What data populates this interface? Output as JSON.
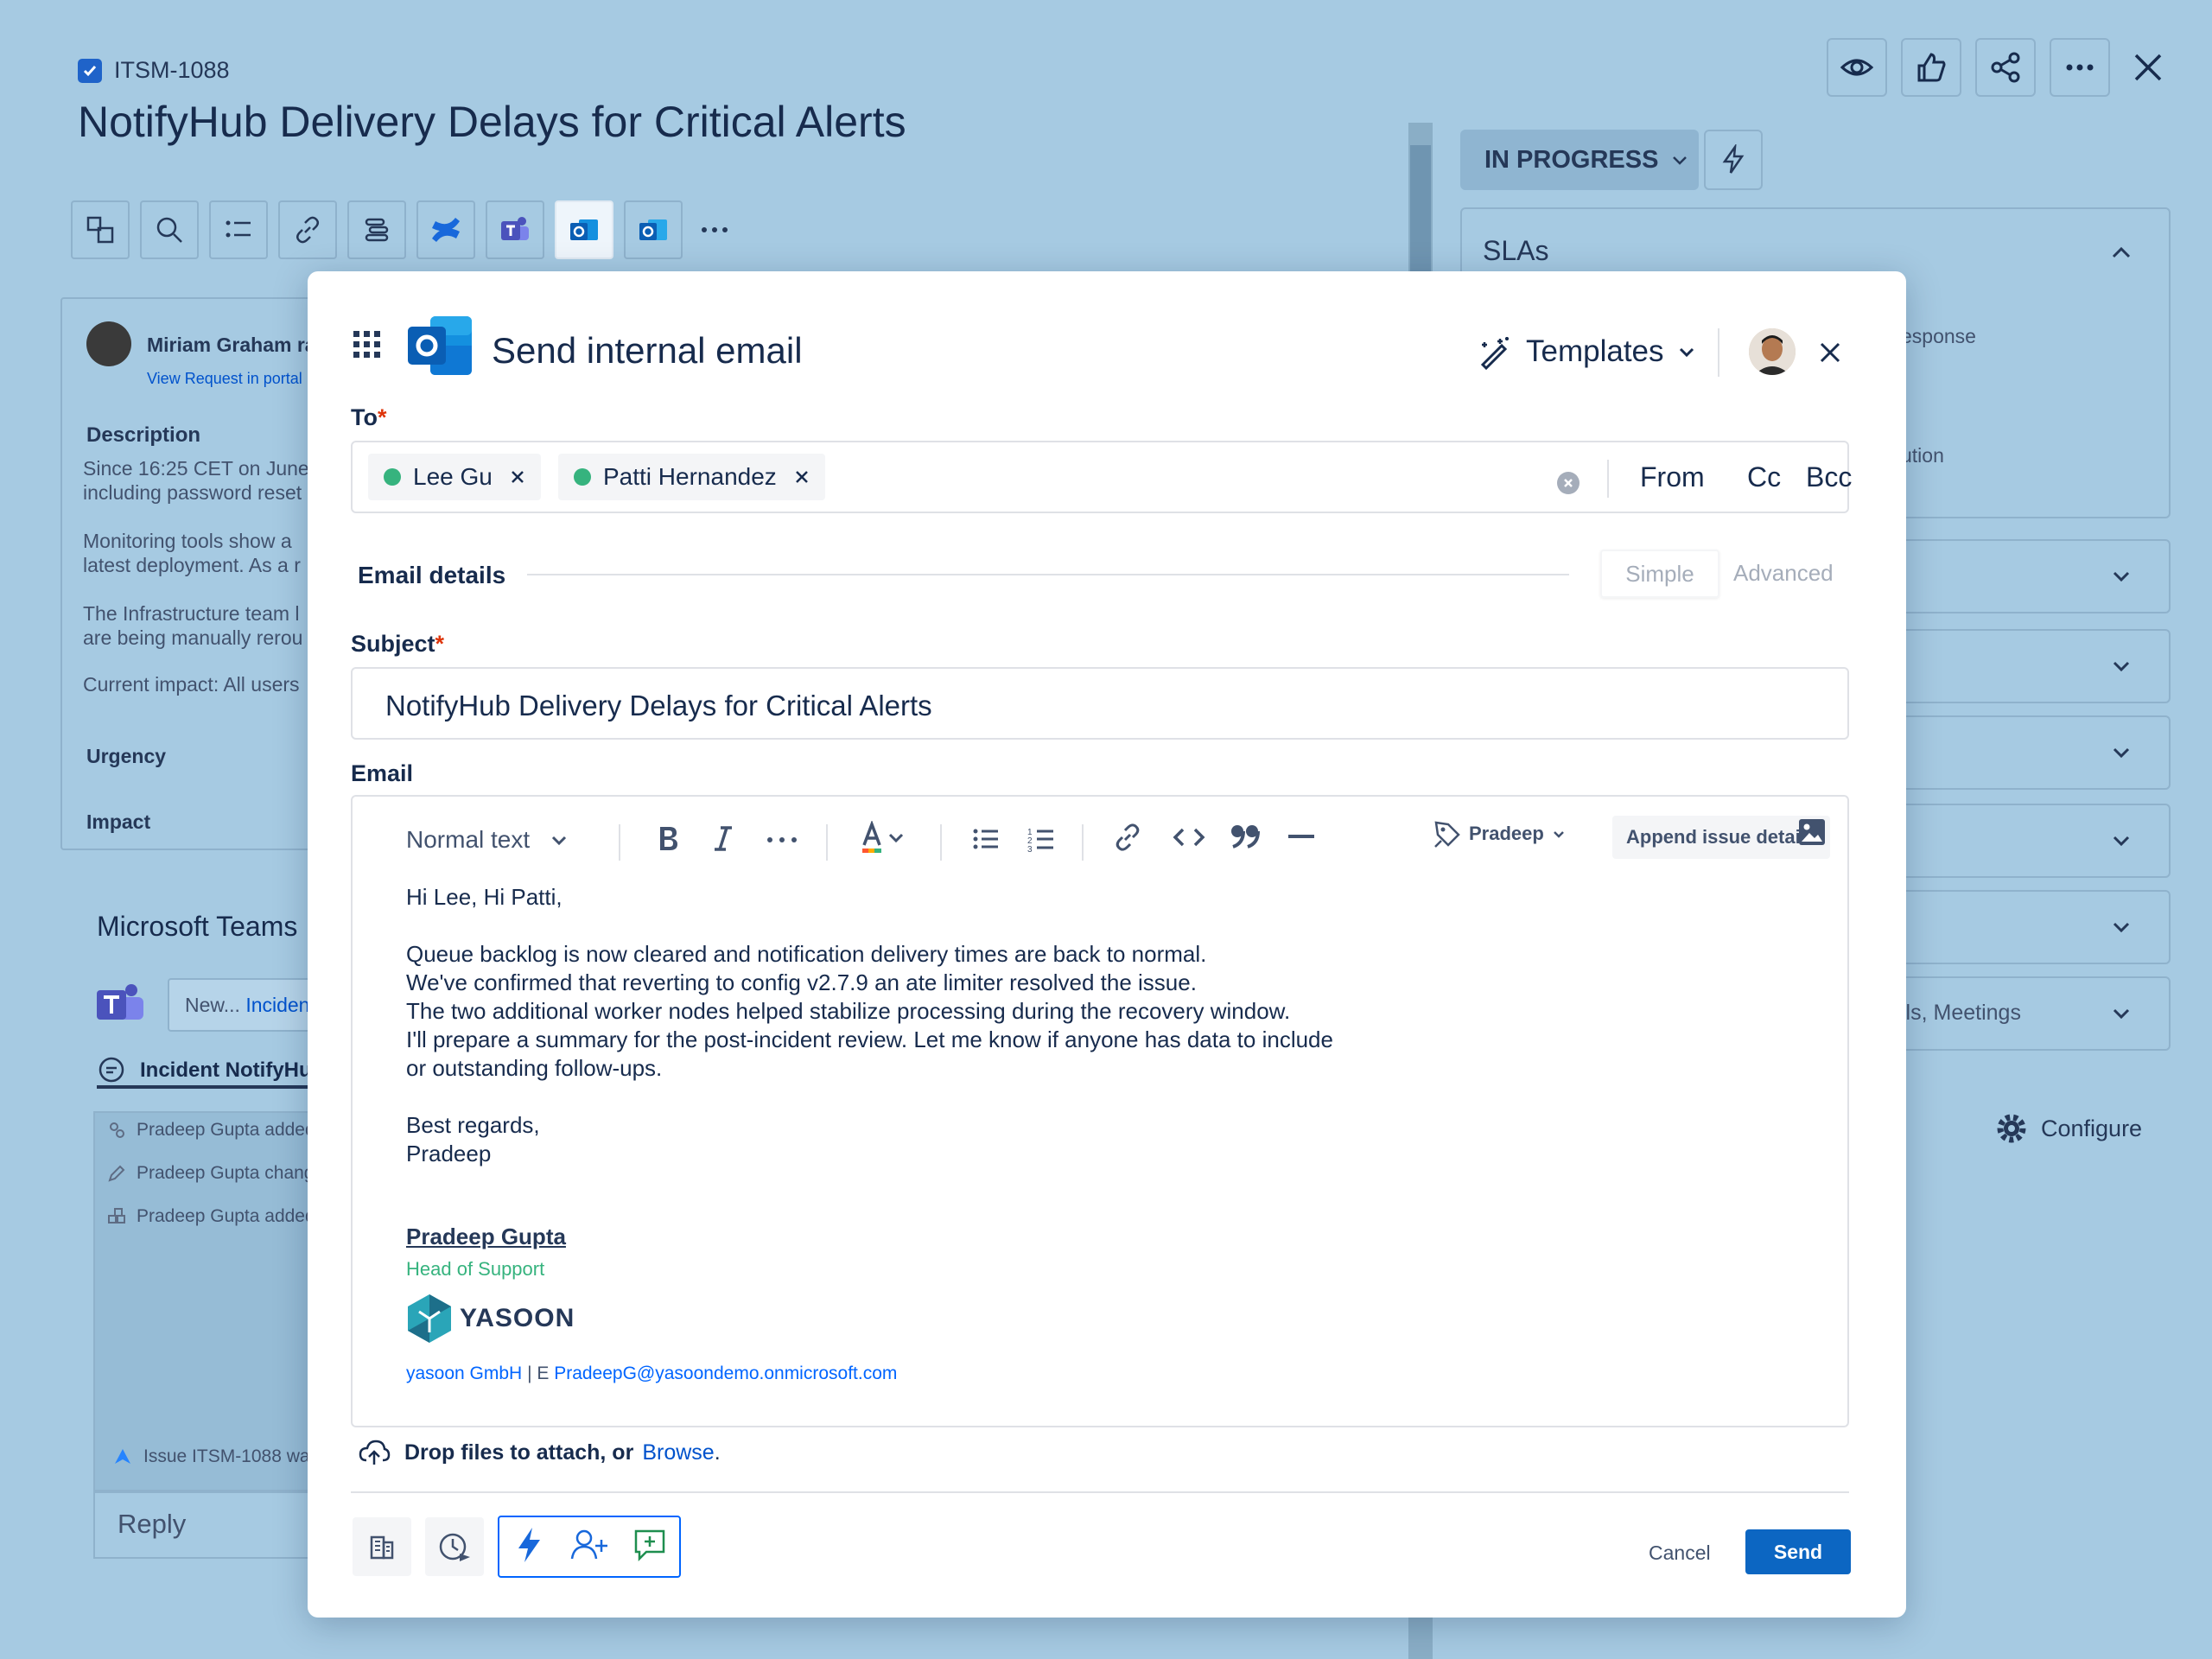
{
  "issue": {
    "key": "ITSM-1088",
    "title": "NotifyHub Delivery Delays for Critical Alerts",
    "status": "IN PROGRESS"
  },
  "sidebar": {
    "sla_title": "SLAs",
    "sla_peek_1": "esponse",
    "sla_peek_2": "ution",
    "meetings_peek": "ils, Meetings",
    "configure": "Configure"
  },
  "request": {
    "reporter": "Miriam Graham ra",
    "portal_link": "View Request in portal",
    "description_heading": "Description",
    "description_1": "Since 16:25 CET on June\nincluding password reset",
    "description_2": "Monitoring tools show a\nlatest deployment. As a r",
    "description_3": "The Infrastructure team l\nare being manually rerou",
    "description_4": "Current impact: All users",
    "urgency": "Urgency",
    "impact": "Impact"
  },
  "teams": {
    "heading": "Microsoft Teams",
    "input_prefix": "New...",
    "input_link": "Inciden",
    "tab": "Incident NotifyHu",
    "activity": [
      "Pradeep Gupta added",
      "Pradeep Gupta chang",
      "Pradeep Gupta added"
    ],
    "issue_note": "Issue ITSM-1088 wa",
    "reply": "Reply"
  },
  "modal": {
    "title": "Send internal email",
    "templates": "Templates",
    "to_label": "To",
    "recipients": [
      "Lee Gu",
      "Patti Hernandez"
    ],
    "from": "From",
    "cc": "Cc",
    "bcc": "Bcc",
    "email_details": "Email details",
    "mode_simple": "Simple",
    "mode_advanced": "Advanced",
    "subject_label": "Subject",
    "subject": "NotifyHub Delivery Delays for Critical Alerts",
    "email_label": "Email",
    "text_style": "Normal text",
    "signature_owner": "Pradeep",
    "append_details": "Append issue details",
    "body": "Hi Lee, Hi Patti,\n\nQueue backlog is now cleared and notification delivery times are back to normal.\nWe've confirmed that reverting to config v2.7.9 an ate limiter resolved the issue.\nThe two additional worker nodes helped stabilize processing during the recovery window.\nI'll prepare a summary for the post-incident review. Let me know if anyone has data to include\nor outstanding follow-ups.\n\nBest regards,\nPradeep",
    "sig_name": "Pradeep Gupta",
    "sig_role": "Head of Support",
    "sig_company_logo": "YASOON",
    "sig_company": "yasoon GmbH",
    "sig_sep": " | E ",
    "sig_email": "PradeepG@yasoondemo.onmicrosoft.com",
    "drop_text": "Drop files to attach, or",
    "browse": "Browse",
    "cancel": "Cancel",
    "send": "Send"
  },
  "colors": {
    "backdrop": "#a6cae2",
    "primary": "#0c66c2",
    "presence": "#36b37e",
    "required": "#de350b"
  }
}
